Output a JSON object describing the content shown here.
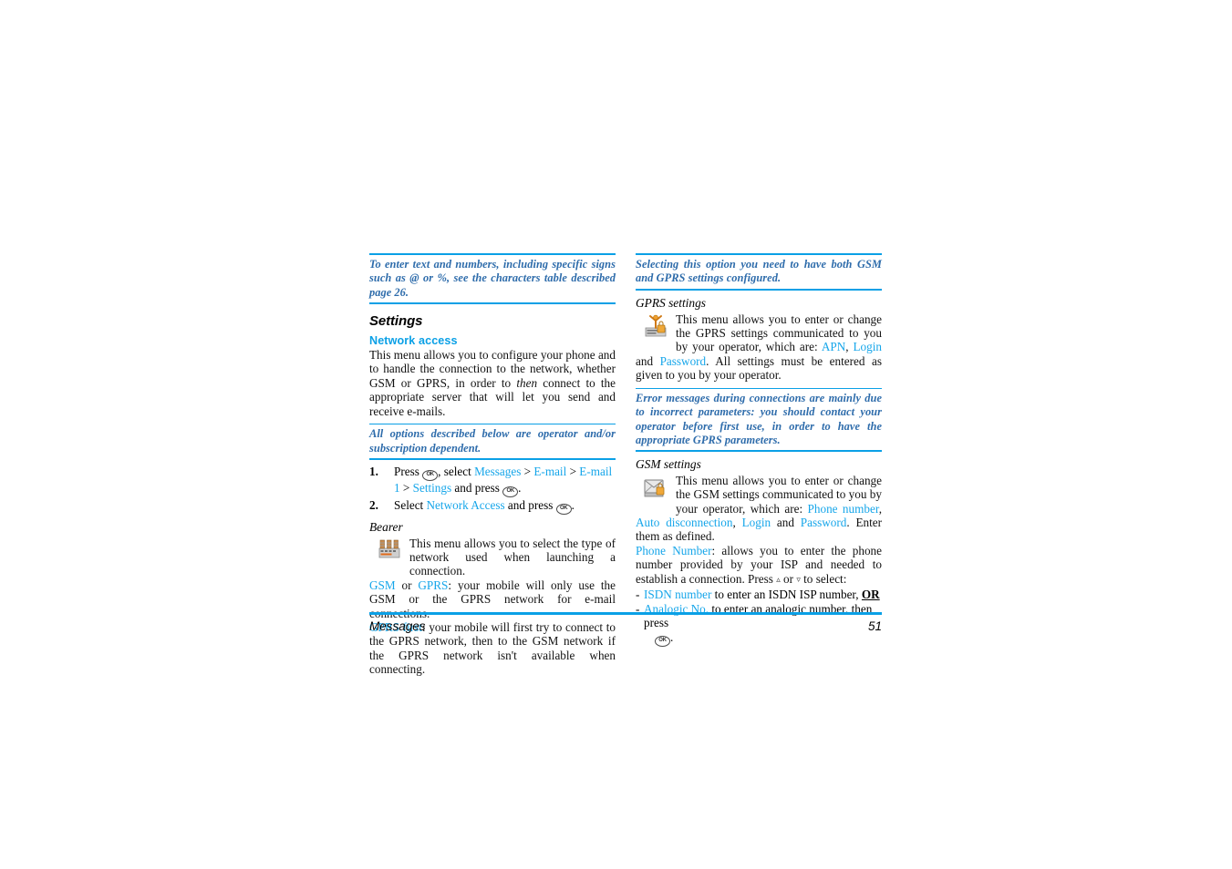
{
  "document": {
    "footer": {
      "section_label": "Messages",
      "page_number": "51"
    },
    "colors": {
      "accent_blue": "#0aa0e6",
      "link_blue": "#16a6ea",
      "note_blue": "#2e6cab",
      "body_black": "#111111"
    }
  },
  "left_column": {
    "note_top": "To enter text and numbers, including specific signs such as @ or %, see the characters table described page 26.",
    "settings_heading": "Settings",
    "network_access_heading": "Network access",
    "network_access_body_1": "This menu allows you to configure your phone and to handle the connection to the network, whether GSM or GPRS, in order to ",
    "network_access_body_italic": "then",
    "network_access_body_2": " connect to the appropriate server that will let you send and receive e-mails.",
    "note_options": "All options described below are operator and/or subscription dependent.",
    "steps": [
      {
        "number": "1.",
        "prefix": "Press",
        "key_1": "OK",
        "mid_1": ", select",
        "link_1": "Messages",
        "sep_1": ">",
        "link_2": "E-mail",
        "sep_2": ">",
        "link_3": "E-mail 1",
        "sep_3": ">",
        "link_4": "Settings",
        "mid_2": "and press",
        "key_2": "OK",
        "suffix": "."
      },
      {
        "number": "2.",
        "prefix": "Select",
        "link_1": "Network Access",
        "mid_1": "and press",
        "key_1": "OK",
        "suffix": "."
      }
    ],
    "bearer_heading": "Bearer",
    "bearer_icon_name": "network-bearer-icon",
    "bearer_body": "This menu allows you to select the type of network used when launching a connection.",
    "gsm_gprs_link_1": "GSM",
    "gsm_gprs_mid": " or ",
    "gsm_gprs_link_2": "GPRS",
    "gsm_gprs_text": ": your mobile will only use the GSM or the GPRS network for e-mail connections.",
    "gprs_first_link": "GPRS first",
    "gprs_first_text": ": your mobile will first try to connect to the GPRS network, then to the GSM network if the GPRS network isn't available when connecting."
  },
  "right_column": {
    "note_top": "Selecting this option you need to have both GSM and GPRS settings configured.",
    "gprs_settings_heading": "GPRS settings",
    "gprs_icon_name": "gprs-settings-icon",
    "gprs_body_1": "This menu allows you to enter or change the GPRS settings communicated to you by your operator, which are: ",
    "gprs_link_apn": "APN",
    "gprs_comma": ", ",
    "gprs_link_login": "Login",
    "gprs_body_and": " and ",
    "gprs_link_password": "Password",
    "gprs_body_2": ". All settings must be entered as given to you by your operator.",
    "note_errors": "Error messages during connections are mainly due to incorrect parameters: you should contact your operator before first use, in order to have the appropriate GPRS parameters.",
    "gsm_settings_heading": "GSM settings",
    "gsm_icon_name": "gsm-settings-icon",
    "gsm_body_1": "This menu allows you to enter or change the GSM settings communicated to you by your operator, which are: ",
    "gsm_link_phone_number": "Phone number",
    "gsm_comma_1": ", ",
    "gsm_link_auto_disconnection": "Auto disconnection",
    "gsm_comma_2": ", ",
    "gsm_link_login": "Login",
    "gsm_and": " and ",
    "gsm_link_password": "Password",
    "gsm_body_2": ". Enter them as defined.",
    "phone_number_link": "Phone Number",
    "phone_number_text_1": ": allows you to enter the phone number provided by your ISP and needed to establish a connection. Press",
    "phone_number_key_up": "▵",
    "phone_number_or": "or",
    "phone_number_key_down": "▿",
    "phone_number_text_2": "to select:",
    "options": [
      {
        "dash": "-",
        "link": "ISDN number",
        "text": " to enter an ISDN ISP number, ",
        "emphasis": "OR"
      },
      {
        "dash": "-",
        "link": "Analogic No.",
        "text": " to enter an analogic number, then press",
        "key": "OK",
        "suffix": "."
      }
    ]
  }
}
